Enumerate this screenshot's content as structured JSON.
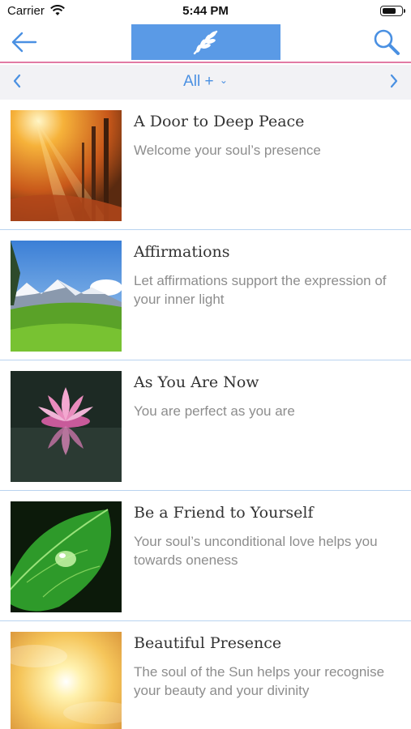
{
  "status": {
    "carrier": "Carrier",
    "time": "5:44 PM",
    "battery_level": 0.75
  },
  "nav": {
    "back_icon": "arrow-left-icon",
    "logo_icon": "wheat-leaf-logo",
    "search_icon": "search-icon"
  },
  "filter": {
    "label": "All +",
    "prev_icon": "chevron-left-icon",
    "next_icon": "chevron-right-icon",
    "dropdown_icon": "chevron-down-icon"
  },
  "colors": {
    "accent_blue": "#4a90e2",
    "logo_bg": "#5a9ae6",
    "divider_pink": "#e27aa4",
    "row_divider": "#b9d3ef"
  },
  "items": [
    {
      "title": "A Door to Deep Peace",
      "subtitle": "Welcome your soul’s presence",
      "image": "autumn-forest-sunlight"
    },
    {
      "title": "Affirmations",
      "subtitle": "Let affirmations support the expression of your inner light",
      "image": "alpine-meadow-mountains"
    },
    {
      "title": "As You Are Now",
      "subtitle": "You are perfect as you are",
      "image": "pink-lotus-reflection"
    },
    {
      "title": "Be a Friend to Yourself",
      "subtitle": "Your soul’s unconditional love helps you towards oneness",
      "image": "green-leaf-water-drop"
    },
    {
      "title": "Beautiful Presence",
      "subtitle": "The soul of the Sun helps your recognise your beauty and your divinity",
      "image": "golden-sun-glow"
    }
  ]
}
